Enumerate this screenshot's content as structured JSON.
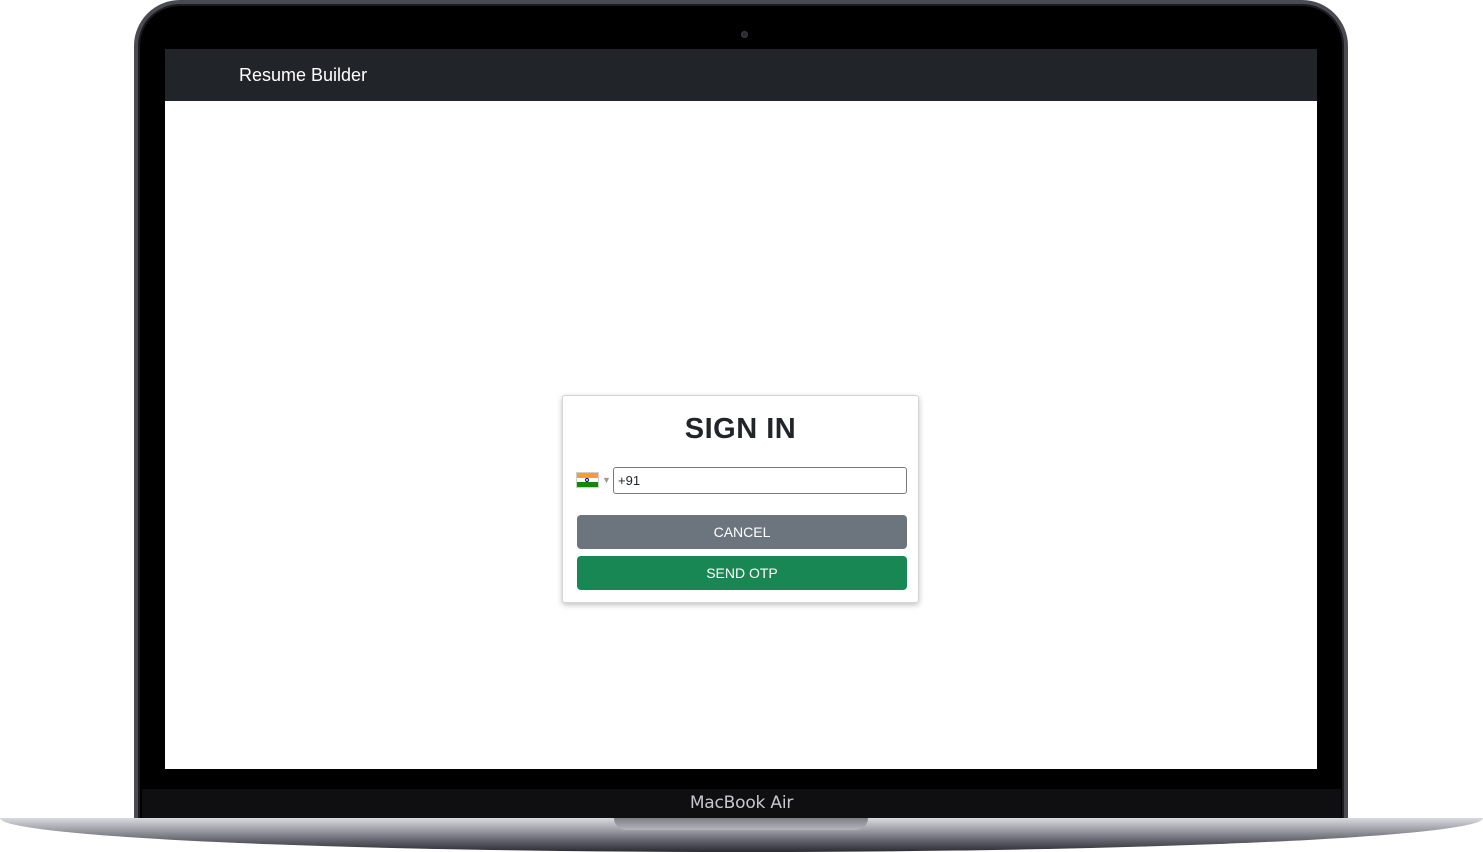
{
  "device": {
    "brand_label": "MacBook Air"
  },
  "navbar": {
    "brand": "Resume Builder",
    "background": "#212529"
  },
  "signin": {
    "title": "SIGN IN",
    "country": {
      "flag_icon": "india-flag-icon",
      "dropdown_icon": "chevron-down-icon"
    },
    "phone": {
      "value": "+91",
      "placeholder": ""
    },
    "cancel_label": "CANCEL",
    "send_otp_label": "SEND OTP",
    "colors": {
      "cancel": "#6c757d",
      "send_otp": "#198754"
    }
  }
}
